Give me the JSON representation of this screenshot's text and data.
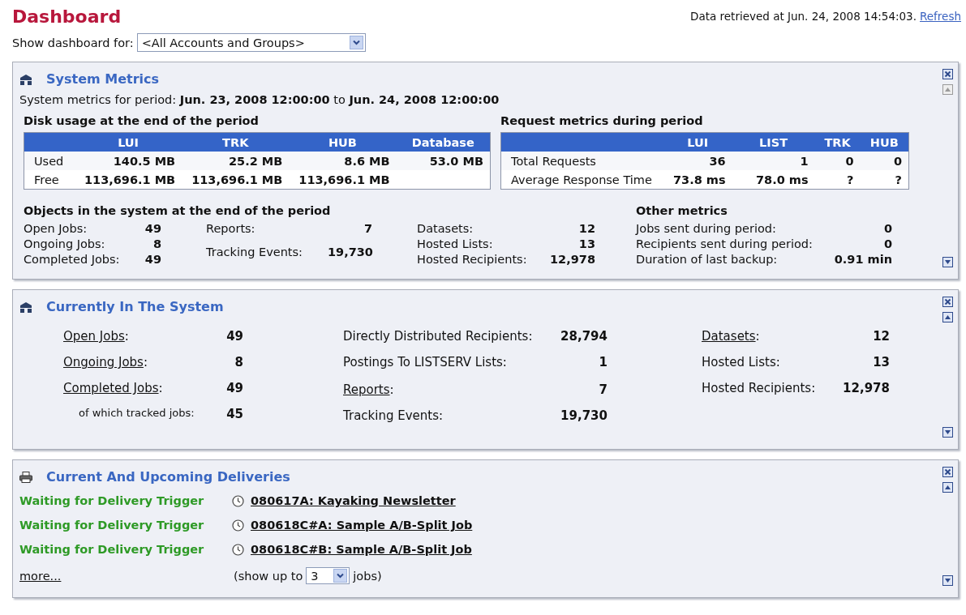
{
  "header": {
    "title": "Dashboard",
    "retrieved": "Data retrieved at Jun. 24, 2008 14:54:03.",
    "refresh": "Refresh"
  },
  "filter": {
    "label": "Show dashboard for:",
    "value": "<All Accounts and Groups>"
  },
  "panels": [
    {
      "kind": "metrics",
      "title": "System Metrics",
      "move_up_disabled": true,
      "period": "System metrics for period: **Jun. 23, 2008 12:00:00** to **Jun. 24, 2008 12:00:00**",
      "disk": {
        "heading": "Disk usage at the end of the period",
        "columns": [
          "LUI",
          "TRK",
          "HUB",
          "Database"
        ],
        "rows": [
          {
            "label": "Used",
            "cells": [
              "140.5 MB",
              "25.2 MB",
              "8.6 MB",
              "53.0 MB"
            ]
          },
          {
            "label": "Free",
            "cells": [
              "113,696.1 MB",
              "113,696.1 MB",
              "113,696.1 MB"
            ]
          }
        ]
      },
      "requests": {
        "heading": "Request metrics during period",
        "columns": [
          "LUI",
          "LIST",
          "TRK",
          "HUB"
        ],
        "rows": [
          {
            "label": "Total Requests",
            "cells": [
              "36",
              "1",
              "0",
              "0"
            ]
          },
          {
            "label": "Average Response Time",
            "cells": [
              "73.8 ms",
              "78.0 ms",
              "?",
              "?"
            ]
          }
        ]
      },
      "objects": {
        "heading": "Objects in the system at the end of the period",
        "groups": [
          [
            {
              "label": "Open Jobs:",
              "value": "49"
            },
            {
              "label": "Ongoing Jobs:",
              "value": "8"
            },
            {
              "label": "Completed Jobs:",
              "value": "49"
            }
          ],
          [
            {
              "label": "Reports:",
              "value": "7"
            },
            {
              "label": "Tracking Events:",
              "value": "19,730"
            }
          ],
          [
            {
              "label": "Datasets:",
              "value": "12"
            },
            {
              "label": "Hosted Lists:",
              "value": "13"
            },
            {
              "label": "Hosted Recipients:",
              "value": "12,978"
            }
          ]
        ]
      },
      "other": {
        "heading": "Other metrics",
        "items": [
          {
            "label": "Jobs sent during period:",
            "value": "0"
          },
          {
            "label": "Recipients sent during period:",
            "value": "0"
          },
          {
            "label": "Duration of last backup:",
            "value": "0.91 min"
          }
        ]
      }
    },
    {
      "kind": "summary",
      "title": "Currently In The System",
      "move_up_disabled": false,
      "columns": [
        [
          [
            {
              "kind": "link",
              "label": "Open Jobs",
              "suffix": ":",
              "value": "49"
            },
            {
              "kind": "link",
              "label": "Ongoing Jobs",
              "suffix": ":",
              "value": "8"
            },
            {
              "kind": "link",
              "label": "Completed Jobs",
              "suffix": ":",
              "value": "49"
            },
            {
              "kind": "sub",
              "label": "of which tracked jobs:",
              "value": "45"
            }
          ]
        ],
        [
          [
            {
              "kind": "text",
              "label": "Directly Distributed Recipients:",
              "value": "28,794"
            },
            {
              "kind": "text",
              "label": "Postings To LISTSERV Lists:",
              "value": "1"
            }
          ],
          [
            {
              "kind": "link",
              "label": "Reports",
              "suffix": ":",
              "value": "7"
            },
            {
              "kind": "text",
              "label": "Tracking Events:",
              "value": "19,730"
            }
          ]
        ],
        [
          [
            {
              "kind": "link",
              "label": "Datasets",
              "suffix": ":",
              "value": "12"
            },
            {
              "kind": "text",
              "label": "Hosted Lists:",
              "value": "13"
            },
            {
              "kind": "text",
              "label": "Hosted Recipients:",
              "value": "12,978"
            }
          ]
        ]
      ]
    },
    {
      "kind": "deliveries",
      "title": "Current And Upcoming Deliveries",
      "move_up_disabled": false,
      "items": [
        {
          "status": "Waiting for Delivery Trigger",
          "job": "080617A: Kayaking Newsletter"
        },
        {
          "status": "Waiting for Delivery Trigger",
          "job": "080618C#A: Sample A/B-Split Job"
        },
        {
          "status": "Waiting for Delivery Trigger",
          "job": "080618C#B: Sample A/B-Split Job"
        }
      ],
      "more": "more...",
      "show_before": "(show up to",
      "show_value": "3",
      "show_after": "jobs)"
    }
  ]
}
